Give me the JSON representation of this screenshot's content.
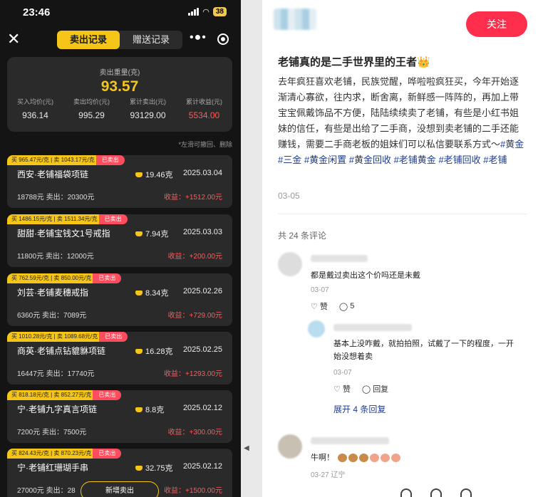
{
  "phone": {
    "status": {
      "time": "23:46",
      "battery": "38"
    },
    "tabs": {
      "sold": "卖出记录",
      "gift": "赠送记录"
    },
    "summary": {
      "weight_label": "卖出重量(克)",
      "weight_value": "93.57",
      "stats": [
        {
          "label": "买入均价(元)",
          "value": "936.14"
        },
        {
          "label": "卖出均价(元)",
          "value": "995.29"
        },
        {
          "label": "累计卖出(元)",
          "value": "93129.00"
        },
        {
          "label": "累计收益(元)",
          "value": "5534.00"
        }
      ]
    },
    "hint": "*左滑可撤回、删除",
    "records": [
      {
        "prices": "买 965.47元/克 | 卖 1043.17元/克",
        "sold": "已卖出",
        "name": "西安·老铺福袋项链",
        "weight": "19.46克",
        "date": "2025.03.04",
        "trade": "18788元  卖出：20300元",
        "profit": "收益：+1512.00元"
      },
      {
        "prices": "买 1486.15元/克 | 卖 1511.34元/克",
        "sold": "已卖出",
        "name": "甜甜·老铺宝钱文1号戒指",
        "weight": "7.94克",
        "date": "2025.03.03",
        "trade": "11800元  卖出：12000元",
        "profit": "收益：+200.00元"
      },
      {
        "prices": "买 762.59元/克 | 卖 850.00元/克",
        "sold": "已卖出",
        "name": "刘芸·老铺麦穗戒指",
        "weight": "8.34克",
        "date": "2025.02.26",
        "trade": "6360元  卖出：7089元",
        "profit": "收益：+729.00元"
      },
      {
        "prices": "买 1010.28元/克 | 卖 1089.68元/克",
        "sold": "已卖出",
        "name": "商英·老铺点钻貔貅项链",
        "weight": "16.28克",
        "date": "2025.02.25",
        "trade": "16447元  卖出：17740元",
        "profit": "收益：+1293.00元"
      },
      {
        "prices": "买 818.18元/克 | 卖 852.27元/克",
        "sold": "已卖出",
        "name": "宁·老铺九字真言项链",
        "weight": "8.8克",
        "date": "2025.02.12",
        "trade": "7200元  卖出：7500元",
        "profit": "收益：+300.00元"
      },
      {
        "prices": "买 824.43元/克 | 卖 870.23元/克",
        "sold": "已卖出",
        "name": "宁·老铺红珊瑚手串",
        "weight": "32.75克",
        "date": "2025.02.12",
        "trade": "27000元  卖出：28",
        "profit": "收益：+1500.00元"
      }
    ],
    "add_label": "新增卖出"
  },
  "post": {
    "follow": "关注",
    "title": "老铺真的是二手世界里的王者👑",
    "body": "去年疯狂喜欢老铺，民族觉醒，哗啦啦疯狂买，今年开始逐渐清心寡欲，往内求，断舍离，新鲜感一阵阵的，再加上带宝宝佩戴饰品不方便，陆陆续续卖了老铺，有些是小红书姐妹的信任，有些是出给了二手商，没想到卖老铺的二手还能赚钱，需要二手商老板的姐妹们可以私信要联系方式～",
    "tags": [
      "#黄金",
      "#三金",
      "#黄金闲置",
      "#黄金回收",
      "#老铺黄金",
      "#老铺回收",
      "#老铺"
    ],
    "date": "03-05",
    "comment_count": "共 24 条评论",
    "comments": [
      {
        "text": "都是戴过卖出这个价吗还是未戴",
        "date": "03-07",
        "like": "赞",
        "reply_count": "5"
      },
      {
        "text": "基本上没咋戴，就拍拍照，试戴了一下的程度，一开始没想着卖",
        "date": "03-07",
        "like": "赞",
        "reply": "回复"
      },
      {
        "text": "牛啊！",
        "date": "03-27",
        "location": "辽宁"
      }
    ],
    "expand": "展开 4 条回复"
  }
}
